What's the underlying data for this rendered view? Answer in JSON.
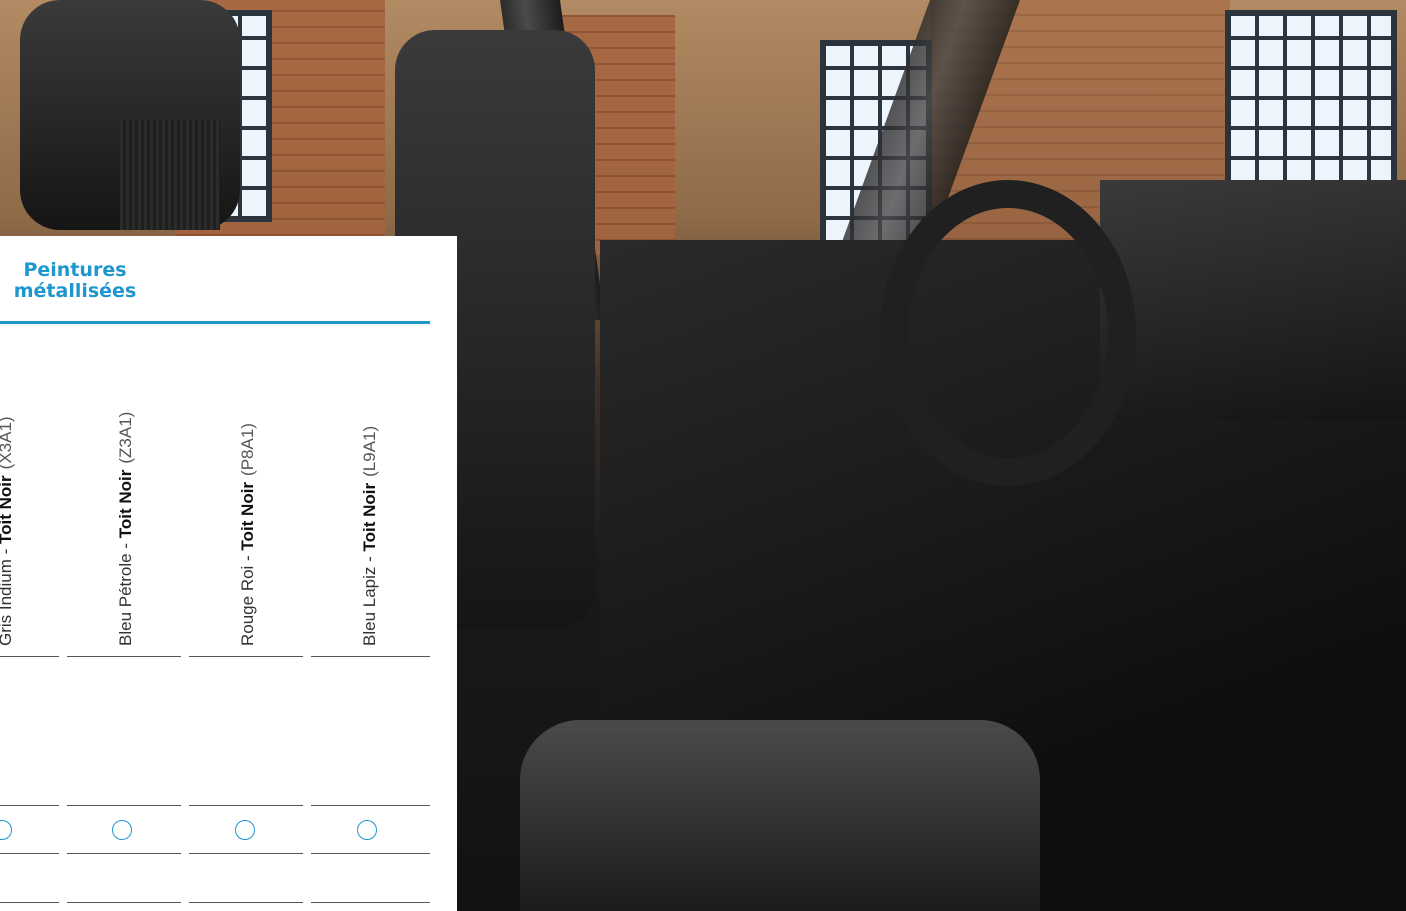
{
  "panel": {
    "title_line1": "Peintures",
    "title_line2": "métallisées",
    "accent_color": "#1e97cf",
    "colors": [
      {
        "name": "Gris Indium - ",
        "roof": "Toit Noir",
        "code": "(X3A1)",
        "selected": false
      },
      {
        "name": "Bleu Pétrole - ",
        "roof": "Toit Noir",
        "code": "(Z3A1)",
        "selected": false
      },
      {
        "name": "Rouge Roi - ",
        "roof": "Toit Noir",
        "code": "(P8A1)",
        "selected": false
      },
      {
        "name": "Bleu Lapiz - ",
        "roof": "Toit Noir",
        "code": "(L9A1)",
        "selected": false
      }
    ]
  },
  "photo": {
    "icon": "car-interior-photo"
  }
}
